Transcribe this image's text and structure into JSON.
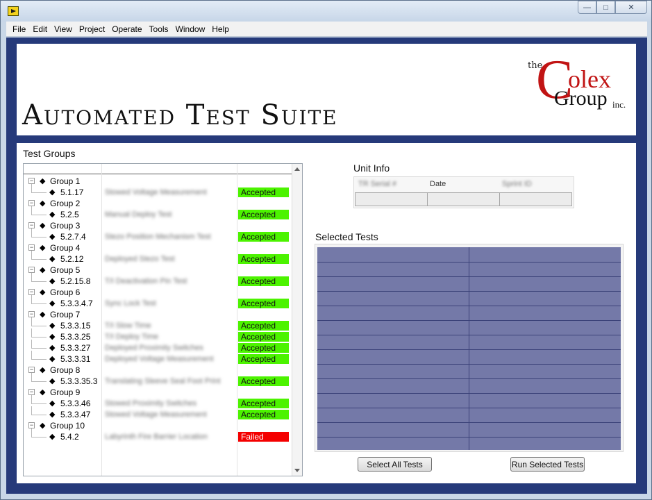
{
  "window": {
    "buttons": [
      "—",
      "□",
      "✕"
    ]
  },
  "menu": [
    "File",
    "Edit",
    "View",
    "Project",
    "Operate",
    "Tools",
    "Window",
    "Help"
  ],
  "header": {
    "title": "Automated Test Suite",
    "logo": {
      "the": "the",
      "c": "C",
      "olex": "olex",
      "group": "Group",
      "inc": "inc."
    }
  },
  "test_groups": {
    "label": "Test Groups",
    "rows": [
      {
        "level": 0,
        "label": "Group 1"
      },
      {
        "level": 1,
        "label": "5.1.17",
        "name": "Stowed Voltage Measurement",
        "status": "Accepted"
      },
      {
        "level": 0,
        "label": "Group 2"
      },
      {
        "level": 1,
        "label": "5.2.5",
        "name": "Manual Deploy Test",
        "status": "Accepted"
      },
      {
        "level": 0,
        "label": "Group 3"
      },
      {
        "level": 1,
        "label": "5.2.7.4",
        "name": "Stezo Position Mechanism Test",
        "status": "Accepted"
      },
      {
        "level": 0,
        "label": "Group 4"
      },
      {
        "level": 1,
        "label": "5.2.12",
        "name": "Deployed Stezo Test",
        "status": "Accepted"
      },
      {
        "level": 0,
        "label": "Group 5"
      },
      {
        "level": 1,
        "label": "5.2.15.8",
        "name": "T/I Deactivation Pin Test",
        "status": "Accepted"
      },
      {
        "level": 0,
        "label": "Group 6"
      },
      {
        "level": 1,
        "label": "5.3.3.4.7",
        "name": "Sync Lock Test",
        "status": "Accepted"
      },
      {
        "level": 0,
        "label": "Group 7"
      },
      {
        "level": 1,
        "label": "5.3.3.15",
        "name": "T/I Slow Time",
        "status": "Accepted"
      },
      {
        "level": 1,
        "label": "5.3.3.25",
        "name": "T/I Deploy Time",
        "status": "Accepted"
      },
      {
        "level": 1,
        "label": "5.3.3.27",
        "name": "Deployed Proximity Switches",
        "status": "Accepted"
      },
      {
        "level": 1,
        "label": "5.3.3.31",
        "name": "Deployed Voltage Measurement",
        "status": "Accepted"
      },
      {
        "level": 0,
        "label": "Group 8"
      },
      {
        "level": 1,
        "label": "5.3.3.35.3",
        "name": "Translating Sleeve Seal Foot Print",
        "status": "Accepted"
      },
      {
        "level": 0,
        "label": "Group 9"
      },
      {
        "level": 1,
        "label": "5.3.3.46",
        "name": "Stowed Proximity Switches",
        "status": "Accepted"
      },
      {
        "level": 1,
        "label": "5.3.3.47",
        "name": "Stowed Voltage Measurement",
        "status": "Accepted"
      },
      {
        "level": 0,
        "label": "Group 10"
      },
      {
        "level": 1,
        "label": "5.4.2",
        "name": "Labyrinth Fire Barrier Location",
        "status": "Failed"
      }
    ]
  },
  "unit_info": {
    "label": "Unit Info",
    "columns": [
      "TR Serial #",
      "Date",
      "Sprint ID"
    ]
  },
  "selected_tests": {
    "label": "Selected Tests"
  },
  "buttons": {
    "select_all": "Select All Tests",
    "run_selected": "Run Selected Tests"
  },
  "colors": {
    "accepted": "#4cf300",
    "failed": "#f40000",
    "panel": "#263a7a",
    "grid": "#7479a8"
  }
}
